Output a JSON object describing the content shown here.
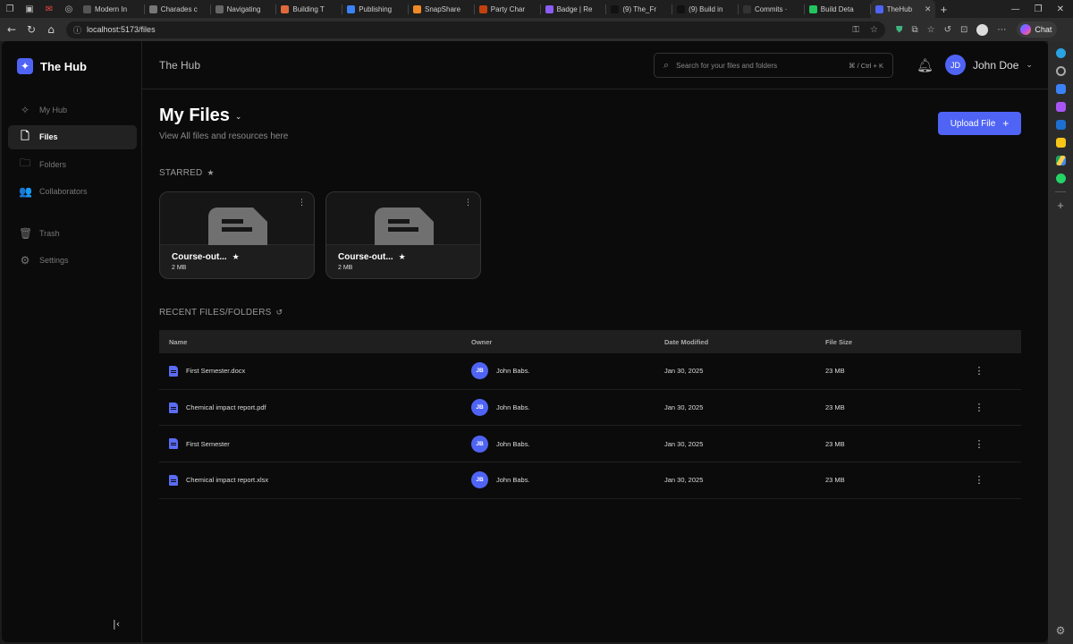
{
  "browser": {
    "tabs": [
      {
        "label": "Modern In",
        "color": "#555"
      },
      {
        "label": "Charades c",
        "color": "#777"
      },
      {
        "label": "Navigating",
        "color": "#666"
      },
      {
        "label": "Building T",
        "color": "#e0693c"
      },
      {
        "label": "Publishing",
        "color": "#3b82f6"
      },
      {
        "label": "SnapShare",
        "color": "#f08a24"
      },
      {
        "label": "Party Char",
        "color": "#c2410c"
      },
      {
        "label": "Badge | Re",
        "color": "#8b5cf6"
      },
      {
        "label": "(9) The_Fr",
        "color": "#111"
      },
      {
        "label": "(9) Build in",
        "color": "#111"
      },
      {
        "label": "Commits ·",
        "color": "#333"
      },
      {
        "label": "Build Deta",
        "color": "#22c55e"
      },
      {
        "label": "TheHub",
        "color": "#4f64f5"
      }
    ],
    "url": "localhost:5173/files",
    "chat_label": "Chat"
  },
  "app": {
    "brand": "The Hub",
    "page_title": "The Hub",
    "nav": [
      {
        "label": "My Hub",
        "icon": "sparkle-icon",
        "glyph": "✧",
        "active": false
      },
      {
        "label": "Files",
        "icon": "file-icon",
        "glyph": "🗋",
        "active": true
      },
      {
        "label": "Folders",
        "icon": "folder-icon",
        "glyph": "🗀",
        "active": false
      },
      {
        "label": "Collaborators",
        "icon": "users-icon",
        "glyph": "👥",
        "active": false
      },
      {
        "label": "Trash",
        "icon": "trash-icon",
        "glyph": "🗑",
        "active": false
      },
      {
        "label": "Settings",
        "icon": "gear-icon",
        "glyph": "⚙",
        "active": false
      }
    ],
    "search": {
      "placeholder": "Search for your files and folders",
      "shortcut": "⌘ / Ctrl + K"
    },
    "user": {
      "initials": "JD",
      "name": "John Doe"
    }
  },
  "main": {
    "title": "My Files",
    "subtitle": "View All files and resources here",
    "upload_label": "Upload File",
    "starred_label": "STARRED",
    "recent_label": "RECENT FILES/FOLDERS",
    "starred": [
      {
        "name": "Course-out...",
        "size": "2 MB"
      },
      {
        "name": "Course-out...",
        "size": "2 MB"
      }
    ],
    "table": {
      "headers": [
        "Name",
        "Owner",
        "Date Modified",
        "File Size"
      ],
      "rows": [
        {
          "name": "First Semester.docx",
          "owner_initials": "JB",
          "owner": "John Babs.",
          "date": "Jan 30, 2025",
          "size": "23 MB"
        },
        {
          "name": "Chemical impact report.pdf",
          "owner_initials": "JB",
          "owner": "John Babs.",
          "date": "Jan 30, 2025",
          "size": "23 MB"
        },
        {
          "name": "First Semester",
          "owner_initials": "JB",
          "owner": "John Babs.",
          "date": "Jan 30, 2025",
          "size": "23 MB"
        },
        {
          "name": "Chemical impact report.xlsx",
          "owner_initials": "JB",
          "owner": "John Babs.",
          "date": "Jan 30, 2025",
          "size": "23 MB"
        }
      ]
    }
  },
  "colors": {
    "accent": "#4f64f5",
    "background": "#0b0b0b"
  }
}
